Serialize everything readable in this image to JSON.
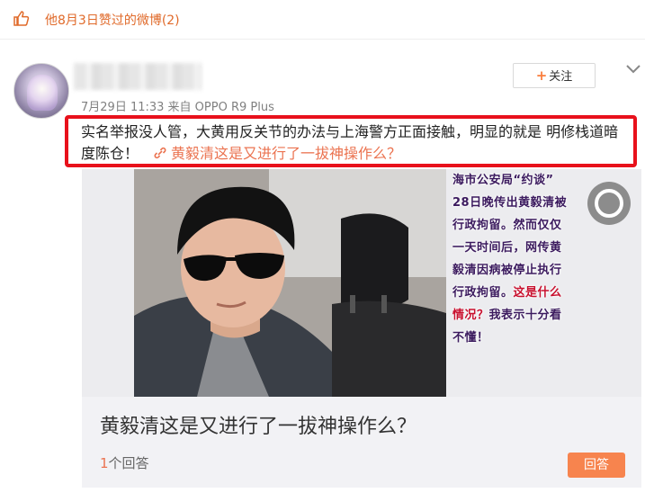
{
  "top_bar": {
    "label": "他8月3日赞过的微博(2)",
    "icon": "thumbs-up-icon"
  },
  "post": {
    "meta": "7月29日 11:33 来自 OPPO R9 Plus",
    "follow_label": "关注",
    "follow_icon": "plus-icon",
    "text": "实名举报没人管，大黄用反关节的办法与上海警方正面接触，明显的就是 明修栈道暗度陈仓！",
    "link_text": "黄毅清这是又进行了一拔神操作么？"
  },
  "card": {
    "side_text_part1": "海市公安局“约谈”\n28日晚传出黄毅清被\n行政拘留。然而仅仅\n一天时间后，网传黄\n毅清因病被停止执行\n行政拘留。",
    "side_text_red": "这是什么\n情况？",
    "side_text_part2": "我表示十分看\n不懂！",
    "title": "黄毅清这是又进行了一拔神操作么？",
    "answer_count": "1",
    "answer_suffix": "个回答",
    "answer_button": "回答"
  },
  "colors": {
    "accent": "#eb7350",
    "highlight_border": "#e8111b",
    "answer_button_bg": "#f7844e"
  }
}
